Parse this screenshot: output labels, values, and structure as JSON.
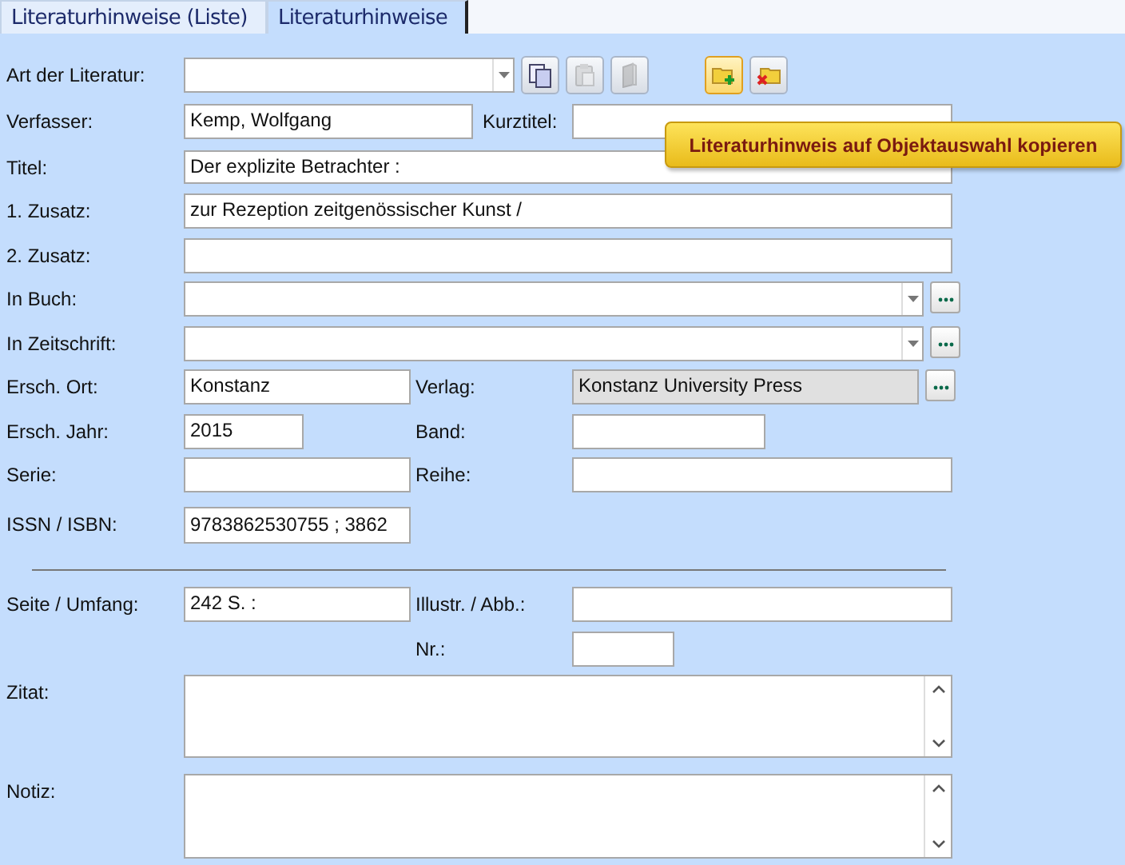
{
  "tabs": [
    {
      "label": "Literaturhinweise (Liste)",
      "selected": false
    },
    {
      "label": "Literaturhinweise",
      "selected": true
    }
  ],
  "toolbar": [
    {
      "kind": "copy",
      "disabled": false,
      "hovered": false
    },
    {
      "kind": "paste",
      "disabled": true,
      "hovered": false
    },
    {
      "kind": "cabinet",
      "disabled": true,
      "hovered": false
    },
    {
      "kind": "add",
      "disabled": false,
      "hovered": true
    },
    {
      "kind": "delete",
      "disabled": false,
      "hovered": false
    }
  ],
  "tooltip": "Literaturhinweis auf Objektauswahl kopieren",
  "form": {
    "art": {
      "label": "Art der Literatur:"
    },
    "verfasser": {
      "label": "Verfasser:",
      "value": "Kemp, Wolfgang"
    },
    "kurztitel": {
      "label": "Kurztitel:"
    },
    "titel": {
      "label": "Titel:",
      "value": "Der explizite Betrachter :"
    },
    "zusatz1": {
      "label": "1. Zusatz:",
      "value": "zur Rezeption zeitgenössischer Kunst /"
    },
    "zusatz2": {
      "label": "2. Zusatz:"
    },
    "in_buch": {
      "label": "In Buch:"
    },
    "in_zeitschrift": {
      "label": "In Zeitschrift:"
    },
    "ersch_ort": {
      "label": "Ersch. Ort:",
      "value": "Konstanz"
    },
    "verlag": {
      "label": "Verlag:",
      "value": "Konstanz University Press",
      "readonly": true
    },
    "ersch_jahr": {
      "label": "Ersch. Jahr:",
      "value": "2015"
    },
    "band": {
      "label": "Band:"
    },
    "serie": {
      "label": "Serie:"
    },
    "reihe": {
      "label": "Reihe:"
    },
    "issn": {
      "label": "ISSN / ISBN:",
      "value": "9783862530755 ; 3862"
    },
    "seite": {
      "label": "Seite / Umfang:",
      "value": "242 S. :"
    },
    "illustr": {
      "label": "Illustr. / Abb.:"
    },
    "nr": {
      "label": "Nr.:"
    },
    "zitat": {
      "label": "Zitat:"
    },
    "notiz": {
      "label": "Notiz:"
    }
  }
}
